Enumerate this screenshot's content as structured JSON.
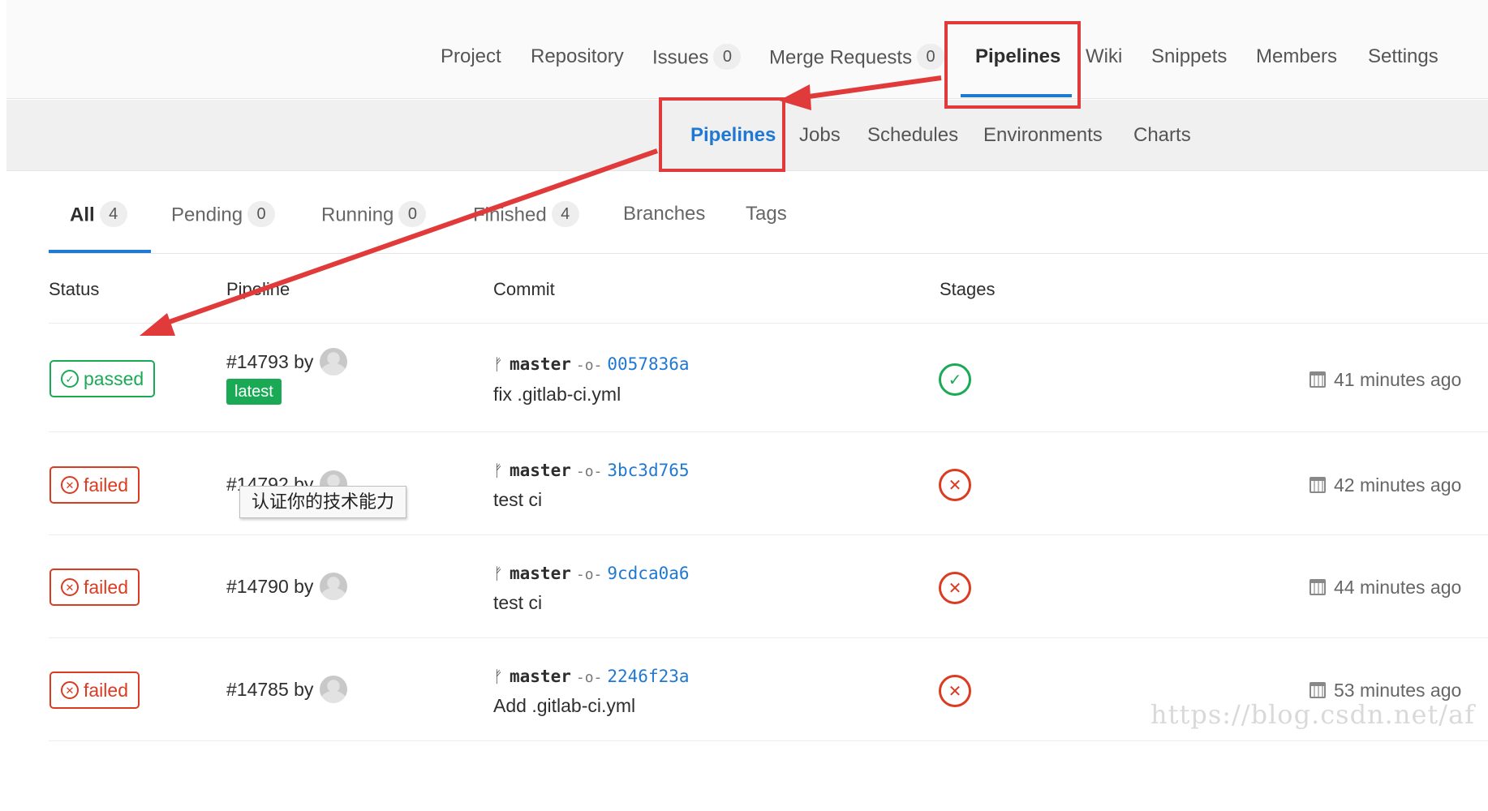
{
  "top_nav": {
    "items": [
      {
        "label": "Project"
      },
      {
        "label": "Repository"
      },
      {
        "label": "Issues",
        "count": "0"
      },
      {
        "label": "Merge Requests",
        "count": "0"
      },
      {
        "label": "Pipelines"
      },
      {
        "label": "Wiki"
      },
      {
        "label": "Snippets"
      },
      {
        "label": "Members"
      },
      {
        "label": "Settings"
      }
    ],
    "active": "Pipelines"
  },
  "sub_nav": {
    "items": [
      {
        "label": "Pipelines"
      },
      {
        "label": "Jobs"
      },
      {
        "label": "Schedules"
      },
      {
        "label": "Environments"
      },
      {
        "label": "Charts"
      }
    ],
    "active": "Pipelines"
  },
  "scope_tabs": [
    {
      "label": "All",
      "count": "4"
    },
    {
      "label": "Pending",
      "count": "0"
    },
    {
      "label": "Running",
      "count": "0"
    },
    {
      "label": "Finished",
      "count": "4"
    },
    {
      "label": "Branches"
    },
    {
      "label": "Tags"
    }
  ],
  "table": {
    "headers": {
      "status": "Status",
      "pipeline": "Pipeline",
      "commit": "Commit",
      "stages": "Stages"
    },
    "rows": [
      {
        "status": "passed",
        "pipeline": "#14793 by",
        "latest": "latest",
        "ref": "master",
        "sha": "0057836a",
        "title": "fix .gitlab-ci.yml",
        "time": "41 minutes ago"
      },
      {
        "status": "failed",
        "pipeline": "#14792 by",
        "ref": "master",
        "sha": "3bc3d765",
        "title": "test ci",
        "time": "42 minutes ago"
      },
      {
        "status": "failed",
        "pipeline": "#14790 by",
        "ref": "master",
        "sha": "9cdca0a6",
        "title": "test ci",
        "time": "44 minutes ago"
      },
      {
        "status": "failed",
        "pipeline": "#14785 by",
        "ref": "master",
        "sha": "2246f23a",
        "title": "Add .gitlab-ci.yml",
        "time": "53 minutes ago"
      }
    ]
  },
  "tooltip": "认证你的技术能力",
  "watermark": "https://blog.csdn.net/af",
  "colors": {
    "accent": "#1f78d1",
    "success": "#1aaa55",
    "danger": "#db3b21",
    "annotation": "#e03a3a"
  },
  "icons": {
    "branch": "branch-icon",
    "commit": "commit-icon",
    "calendar": "calendar-icon",
    "status_passed": "check-circle-icon",
    "status_failed": "x-circle-icon"
  }
}
